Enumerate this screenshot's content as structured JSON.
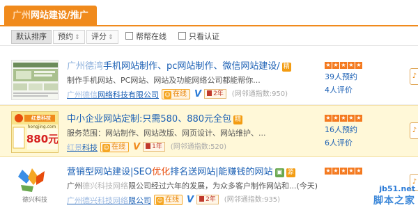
{
  "header": {
    "tab_blur": "广州",
    "tab_label": "网站建设/推广"
  },
  "sortbar": {
    "default_sort": "默认排序",
    "booking_sort": "预约",
    "rating_sort": "评分",
    "arrow": "⇕",
    "filter_online": "帮帮在线",
    "filter_verified": "只看认证"
  },
  "listings": [
    {
      "title_blur": "广州德湾",
      "title": "手机网站制作、pc网站制作、微信网站建设/",
      "desc": "制作手机网站、PC网站、网站及功能网络公司都能帮你...",
      "company_blur": "广州德信",
      "company": "网络科技有限公司",
      "online": "在线",
      "verified": "V",
      "years": "2年",
      "index": "(网邻通指数:950)",
      "bookings": "39人预约",
      "reviews": "4人评价"
    },
    {
      "title": "中小企业网站定制:只需580、880元全包",
      "desc": "服务范围：网站制作、网站改版、网页设计、网站维护、...",
      "company_blur": "红景",
      "company": "科技",
      "online": "在线",
      "verified": "V",
      "years": "1年",
      "index": "(网邻通指数:520)",
      "bookings": "16人预约",
      "reviews": "6人评价",
      "thumb_brand": "红景科技",
      "thumb_site": "hongjing.com",
      "thumb_price": "880元"
    },
    {
      "title_a": "营销型网站建设|SEO",
      "title_hot": "优化",
      "title_b": "排名送网站|能赚钱的网站",
      "desc_a": "广州",
      "desc_blur": "德兴科技网络",
      "desc_b": "限公司经过六年的发展，为众多客户制作网站和...(今天)",
      "company_blur": "广州德兴科技网络",
      "company": "限公司",
      "online": "在线",
      "verified": "V",
      "years": "2年",
      "index": "(网邻通指数:935)",
      "thumb_brand": "德兴科技"
    }
  ],
  "watermark": {
    "site": "jb51.net",
    "brand": "脚本之家"
  }
}
